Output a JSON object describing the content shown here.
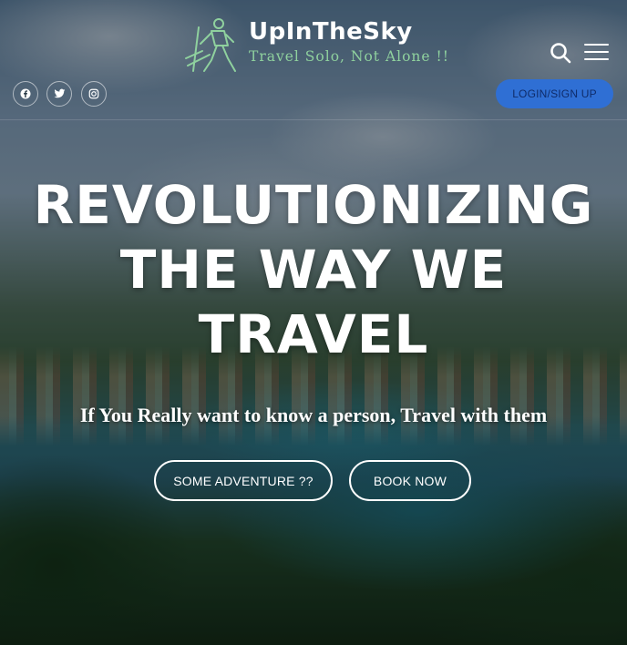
{
  "brand": {
    "title": "UpInTheSky",
    "tagline": "Travel Solo, Not Alone !!"
  },
  "header": {
    "login_label": "LOGIN/SIGN UP",
    "social_icons": [
      "facebook-icon",
      "twitter-icon",
      "instagram-icon"
    ]
  },
  "hero": {
    "headline_lines": [
      "REVOLUTIONIZING",
      "THE WAY WE",
      "TRAVEL"
    ],
    "subheadline": "If You Really want to know a person, Travel with them",
    "buttons": {
      "adventure_label": "SOME ADVENTURE ??",
      "book_label": "BOOK NOW"
    }
  },
  "colors": {
    "accent": "#2f6fd4",
    "tagline_green": "#8fd19e",
    "text": "#ffffff"
  }
}
